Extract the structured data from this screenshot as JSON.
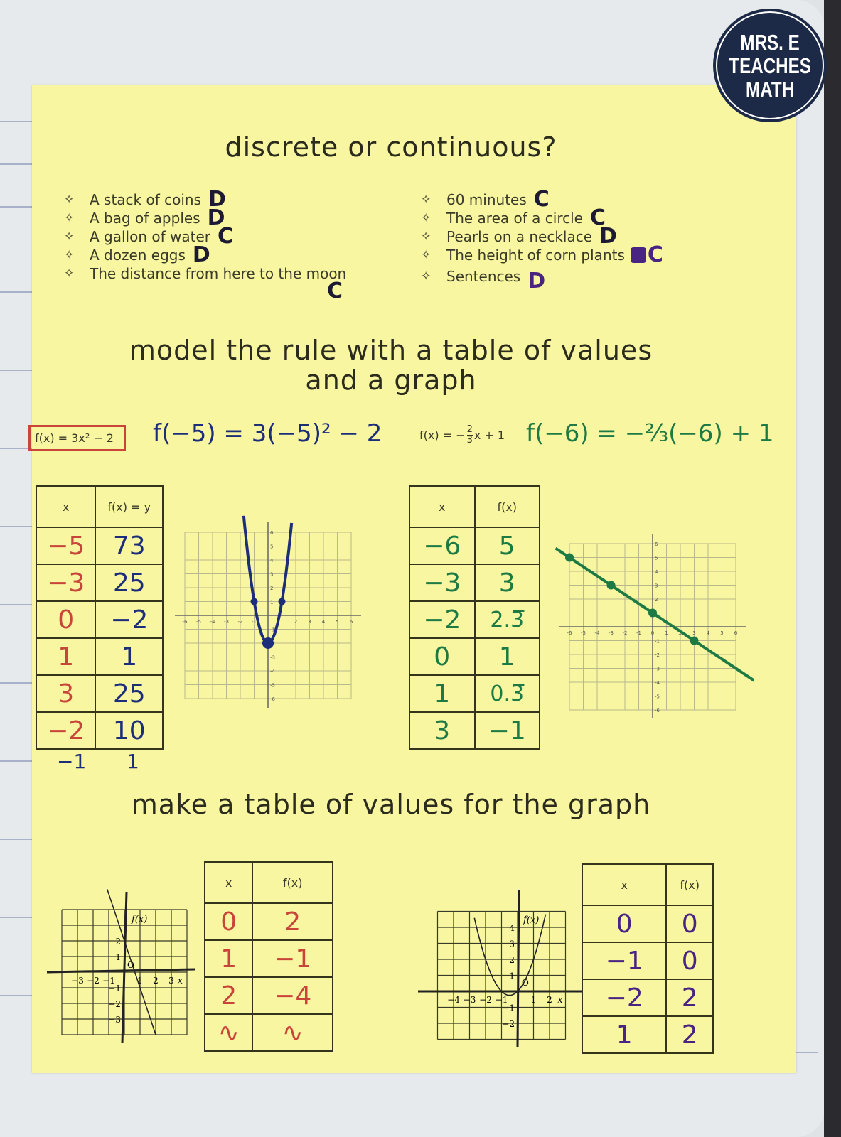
{
  "logo": {
    "text": "MRS. E\nTEACHES\nMATH",
    "bg_color": "#1c2a48"
  },
  "section1": {
    "title": "discrete or continuous?",
    "bullet_icon": "four-point-star-icon",
    "left_items": [
      {
        "label": "A stack of coins",
        "answer": "D"
      },
      {
        "label": "A bag of apples",
        "answer": "D"
      },
      {
        "label": "A gallon of water",
        "answer": "C"
      },
      {
        "label": "A dozen eggs",
        "answer": "D"
      },
      {
        "label": "The distance from here to the moon",
        "answer": "C"
      }
    ],
    "right_items": [
      {
        "label": "60 minutes",
        "answer": "C"
      },
      {
        "label": "The area of a circle",
        "answer": "C"
      },
      {
        "label": "Pearls on a necklace",
        "answer": "D"
      },
      {
        "label": "The height of corn plants",
        "answer": "C"
      },
      {
        "label": "Sentences",
        "answer": "D"
      }
    ]
  },
  "section2": {
    "title_line1": "model the rule with a table of values",
    "title_line2": "and a graph",
    "left": {
      "rule": "f(x) = 3x² − 2",
      "work": "f(−5) = 3(−5)² − 2",
      "headers": [
        "x",
        "f(x) = y"
      ],
      "rows": [
        [
          "−5",
          "73"
        ],
        [
          "−3",
          "25"
        ],
        [
          "0",
          "−2"
        ],
        [
          "1",
          "1"
        ],
        [
          "3",
          "25"
        ],
        [
          "−2",
          "10"
        ]
      ],
      "extra_row": [
        "−1",
        "1"
      ],
      "graph_ticks": [
        "-6",
        "-5",
        "-4",
        "-3",
        "-2",
        "-1",
        "0",
        "1",
        "2",
        "3",
        "4",
        "5",
        "6"
      ]
    },
    "right": {
      "rule_prefix": "f(x) = −",
      "rule_num": "2",
      "rule_den": "3",
      "rule_suffix": "x + 1",
      "work": "f(−6) = −⅔(−6) + 1",
      "headers": [
        "x",
        "f(x)"
      ],
      "rows": [
        [
          "−6",
          "5"
        ],
        [
          "−3",
          "3"
        ],
        [
          "−2",
          "2.3̅"
        ],
        [
          "0",
          "1"
        ],
        [
          "1",
          "0.3̅"
        ],
        [
          "3",
          "−1"
        ]
      ],
      "graph_ticks": [
        "-6",
        "-5",
        "-4",
        "-3",
        "-2",
        "-1",
        "0",
        "1",
        "2",
        "3",
        "4",
        "5",
        "6"
      ]
    }
  },
  "section3": {
    "title": "make a table of values for the graph",
    "left": {
      "axis_label_y": "f(x)",
      "axis_label_x": "x",
      "origin": "O",
      "x_ticks": [
        "−3",
        "−2",
        "−1",
        "1",
        "2",
        "3"
      ],
      "y_ticks": [
        "2",
        "1",
        "−1",
        "−2",
        "−3"
      ],
      "headers": [
        "x",
        "f(x)"
      ],
      "rows": [
        [
          "0",
          "2"
        ],
        [
          "1",
          "−1"
        ],
        [
          "2",
          "−4"
        ],
        [
          "∿",
          "∿"
        ]
      ]
    },
    "right": {
      "axis_label_y": "f(x)",
      "axis_label_x": "x",
      "origin": "O",
      "x_ticks": [
        "−4",
        "−3",
        "−2",
        "−1",
        "1",
        "2"
      ],
      "y_ticks": [
        "4",
        "3",
        "2",
        "1",
        "−1",
        "−2"
      ],
      "headers": [
        "x",
        "f(x)"
      ],
      "rows": [
        [
          "0",
          "0"
        ],
        [
          "−1",
          "0"
        ],
        [
          "−2",
          "2"
        ],
        [
          "1",
          "2"
        ]
      ]
    }
  },
  "colors": {
    "paper": "#f8f6a0",
    "blue_ink": "#1c2d7a",
    "green_ink": "#1d7a44",
    "red_ink": "#c9453a",
    "purple_ink": "#4a2483"
  }
}
